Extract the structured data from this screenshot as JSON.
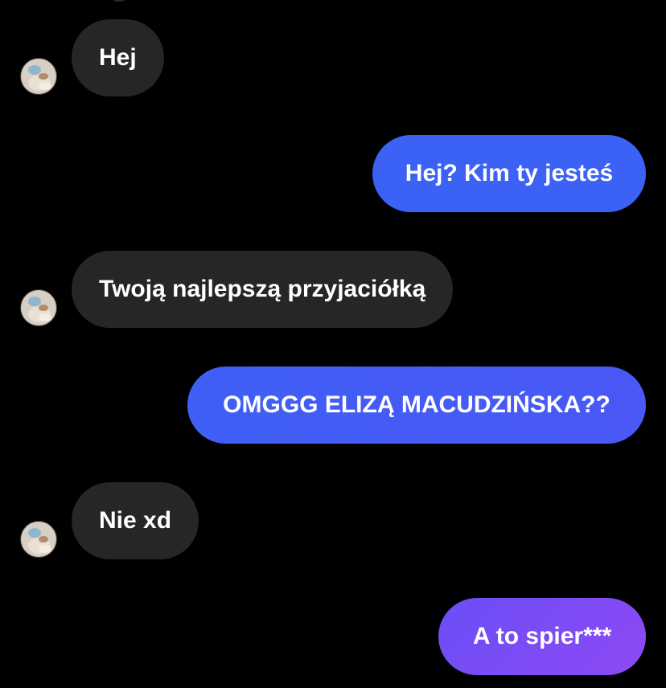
{
  "colors": {
    "background": "#000000",
    "incoming_bubble": "#262626",
    "outgoing_gradient_top": "#3a63f5",
    "outgoing_gradient_bottom": "#8a4cf5",
    "text": "#ffffff"
  },
  "messages": [
    {
      "direction": "incoming",
      "text": "Hej",
      "avatar": "profile-photo-icon"
    },
    {
      "direction": "outgoing",
      "text": "Hej? Kim ty jesteś"
    },
    {
      "direction": "incoming",
      "text": "Twoją najlepszą przyjaciółką",
      "avatar": "profile-photo-icon"
    },
    {
      "direction": "outgoing",
      "text": "OMGGG ELIZĄ MACUDZIŃSKA??"
    },
    {
      "direction": "incoming",
      "text": "Nie xd",
      "avatar": "profile-photo-icon"
    },
    {
      "direction": "outgoing",
      "text": "A to spier***"
    }
  ]
}
